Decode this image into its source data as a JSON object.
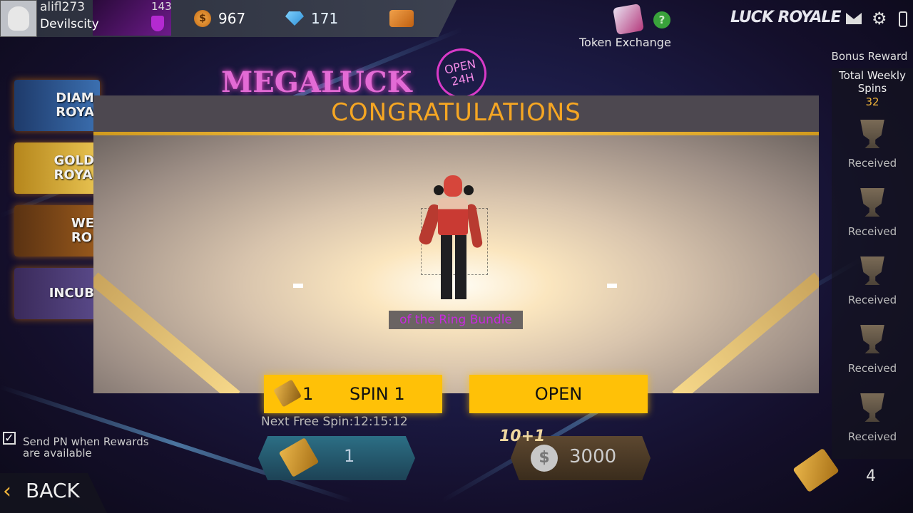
{
  "header": {
    "username": "alifl273",
    "guild": "Devilscity",
    "level": "143",
    "coins": "967",
    "diamonds": "171"
  },
  "token_exchange": {
    "label": "Token Exchange"
  },
  "mode_title": "LUCK ROYALE",
  "sidebar": {
    "items": [
      {
        "label": "DIAM\nROYA"
      },
      {
        "label": "GOLD\nROYA"
      },
      {
        "label": "WE\nRO"
      },
      {
        "label": "INCUB"
      }
    ]
  },
  "banner": {
    "title": "MEGALUCK",
    "badge_line1": "OPEN",
    "badge_line2": "24H"
  },
  "bonus": {
    "title": "Bonus Reward",
    "weekly_label": "Total Weekly Spins",
    "weekly_count": "32",
    "rewards": [
      {
        "status": "Received"
      },
      {
        "status": "Received"
      },
      {
        "status": "Received"
      },
      {
        "status": "Received"
      },
      {
        "status": "Received"
      }
    ],
    "ticket_count": "4"
  },
  "notify": {
    "label": "Send PN when Rewards are available",
    "checked": true
  },
  "back": {
    "label": "BACK"
  },
  "spin_panel": {
    "next_free_label": "Next Free Spin:12:15:12",
    "ticket_value": "1",
    "bundle_label": "10+1",
    "diamond_value": "3000"
  },
  "modal": {
    "title": "CONGRATULATIONS",
    "item_name": "of the Ring Bundle",
    "spin_count": "1",
    "spin_label": "SPIN 1",
    "open_label": "OPEN"
  },
  "colors": {
    "accent": "#ffc107",
    "title_orange": "#f5a623",
    "item_magenta": "#c82adf"
  }
}
